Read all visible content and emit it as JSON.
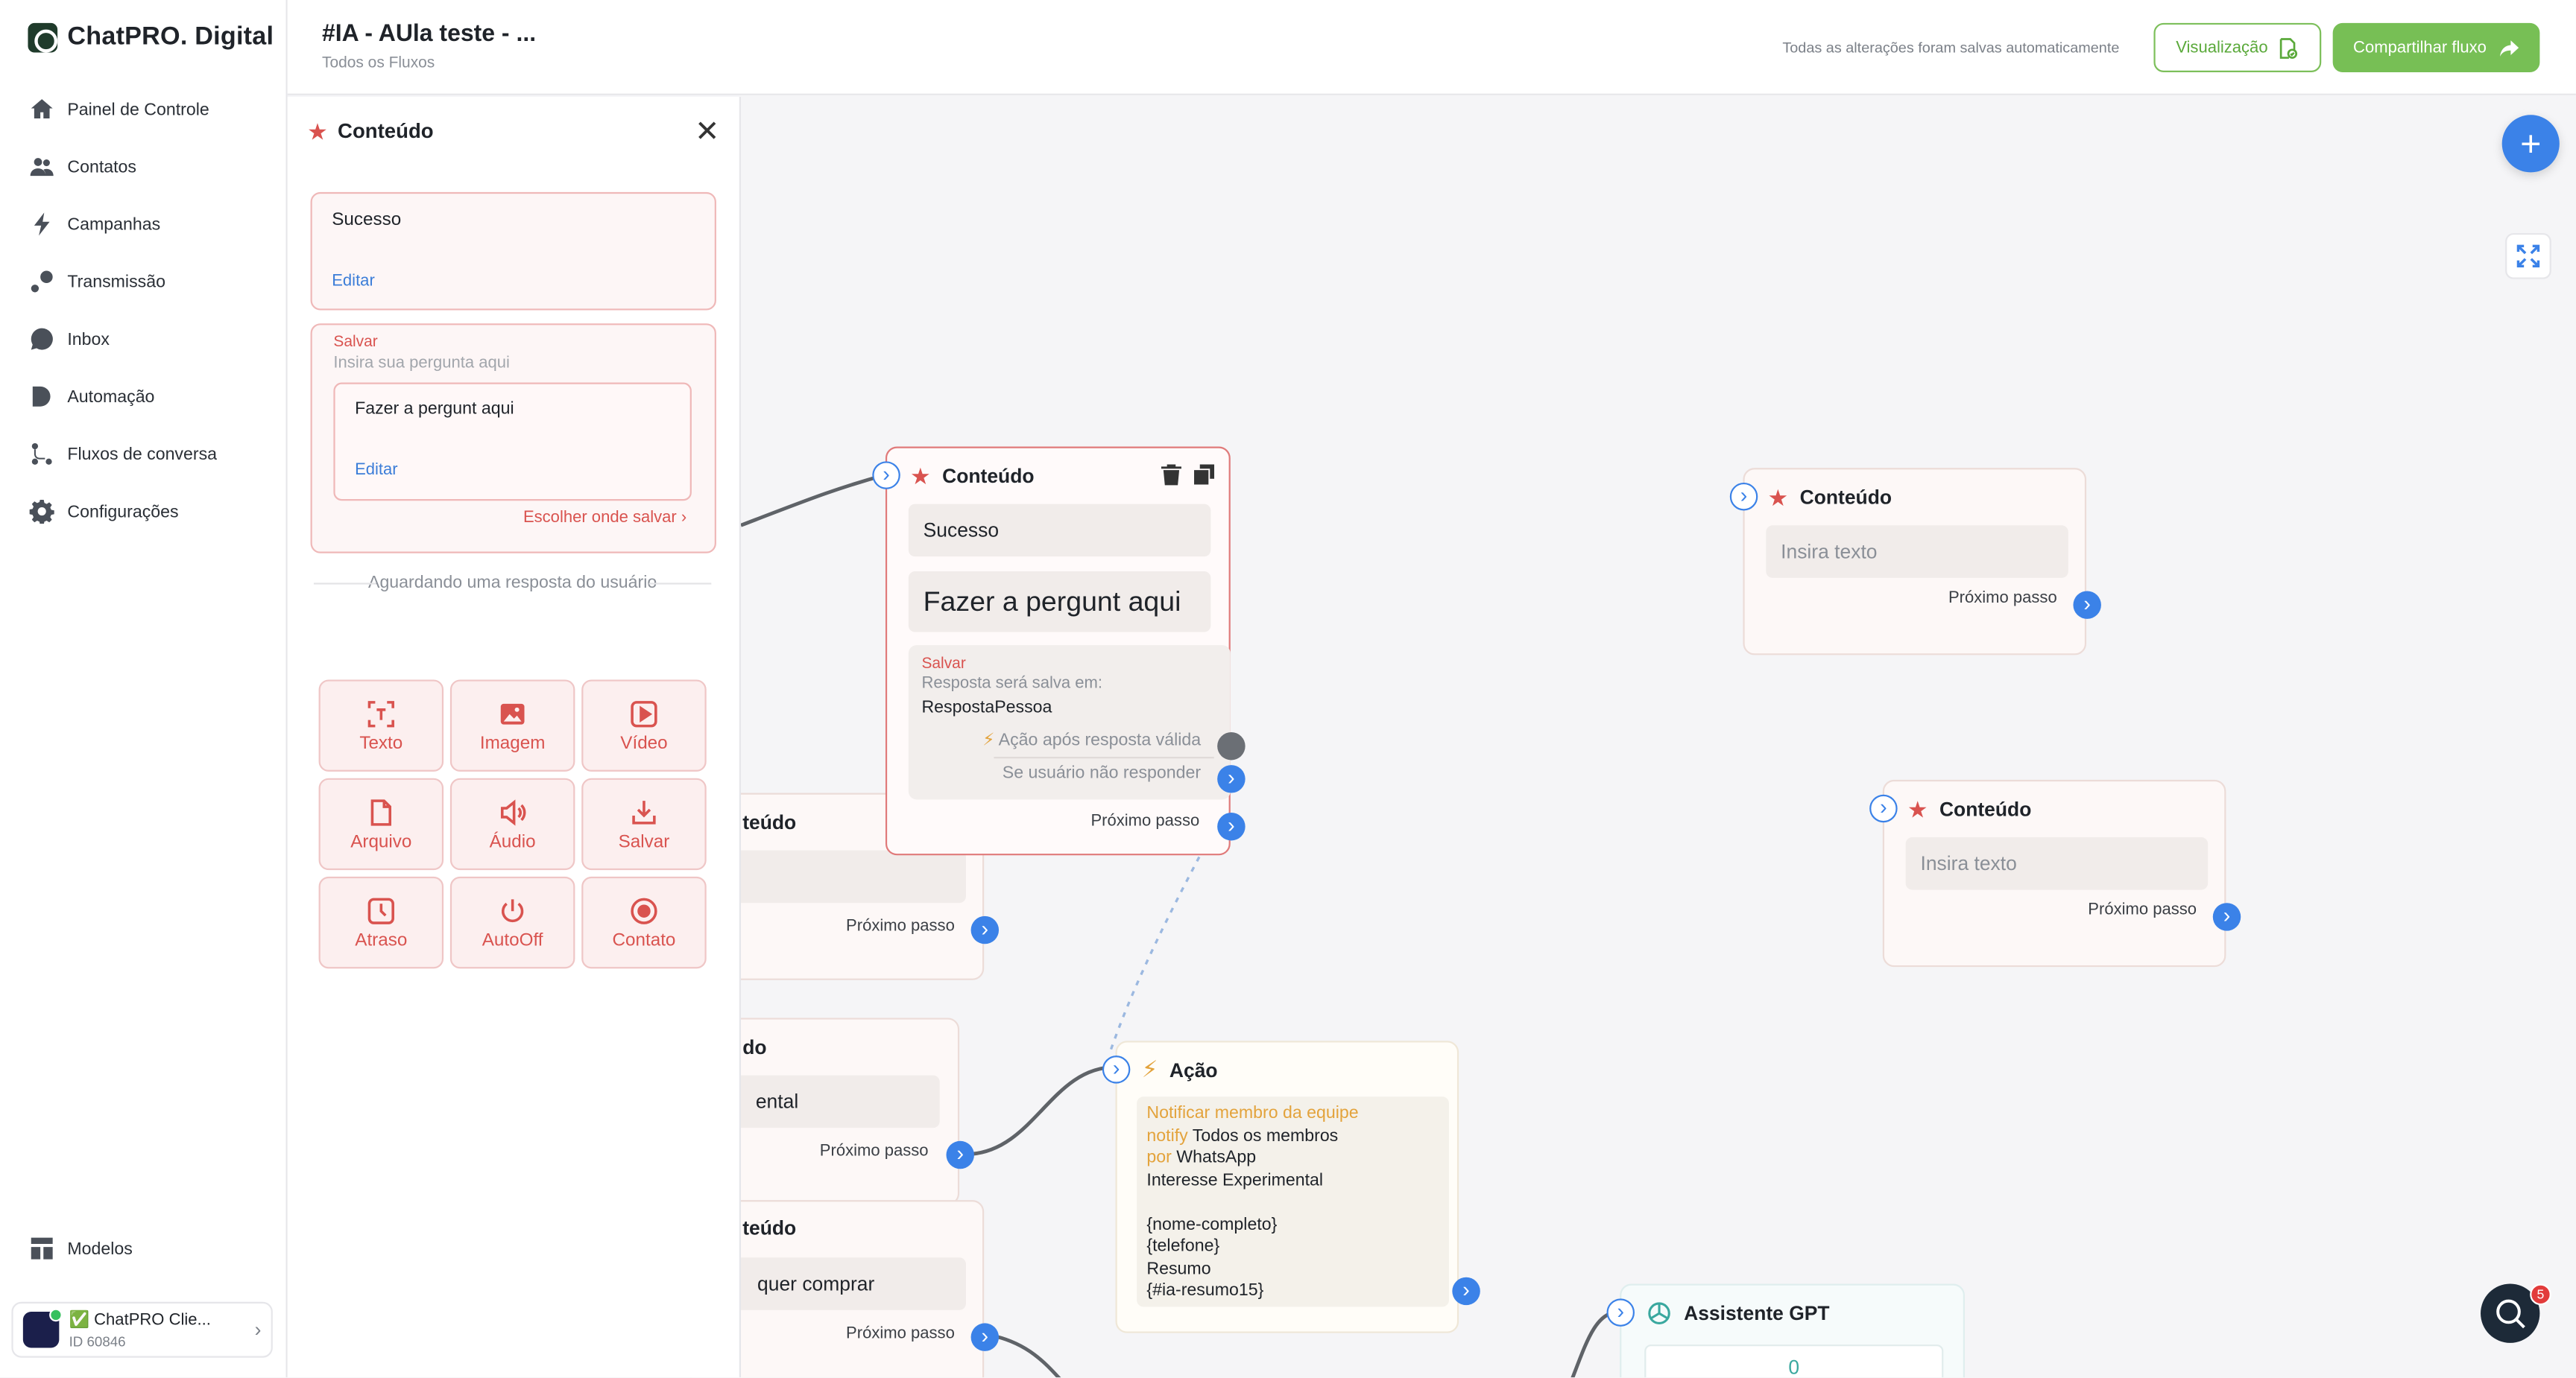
{
  "brand": {
    "name": "ChatPRO. Digital"
  },
  "sidebar": {
    "items": [
      {
        "label": "Painel de Controle",
        "icon": "home-icon"
      },
      {
        "label": "Contatos",
        "icon": "users-icon"
      },
      {
        "label": "Campanhas",
        "icon": "bolt-icon"
      },
      {
        "label": "Transmissão",
        "icon": "broadcast-icon"
      },
      {
        "label": "Inbox",
        "icon": "chat-bubble-icon"
      },
      {
        "label": "Automação",
        "icon": "automation-icon"
      },
      {
        "label": "Fluxos de conversa",
        "icon": "flow-icon"
      },
      {
        "label": "Configurações",
        "icon": "gear-icon"
      }
    ],
    "bottom_item": {
      "label": "Modelos",
      "icon": "templates-icon"
    },
    "account": {
      "name": "✅ ChatPRO Clie...",
      "id": "ID 60846"
    }
  },
  "header": {
    "title": "#IA - AUla teste - ...",
    "breadcrumb": "Todos os Fluxos",
    "autosave": "Todas as alterações foram salvas automaticamente",
    "preview_label": "Visualização",
    "share_label": "Compartilhar fluxo"
  },
  "panel": {
    "title": "Conteúdo",
    "box1_text": "Sucesso",
    "box1_edit": "Editar",
    "save_label": "Salvar",
    "question_placeholder": "Insira sua pergunta aqui",
    "question_text": "Fazer a pergunt aqui",
    "question_edit": "Editar",
    "choose_save": "Escolher onde salvar",
    "waiting": "Aguardando uma resposta do usuário",
    "buttons": [
      {
        "label": "Texto",
        "icon": "text-icon"
      },
      {
        "label": "Imagem",
        "icon": "image-icon"
      },
      {
        "label": "Vídeo",
        "icon": "video-icon"
      },
      {
        "label": "Arquivo",
        "icon": "file-icon"
      },
      {
        "label": "Áudio",
        "icon": "audio-icon"
      },
      {
        "label": "Salvar",
        "icon": "download-icon"
      },
      {
        "label": "Atraso",
        "icon": "clock-icon"
      },
      {
        "label": "AutoOff",
        "icon": "power-icon"
      },
      {
        "label": "Contato",
        "icon": "contact-icon"
      }
    ]
  },
  "canvas": {
    "selected_node": {
      "title": "Conteúdo",
      "field1": "Sucesso",
      "field2": "Fazer a pergunt aqui",
      "save_label": "Salvar",
      "save_sub": "Resposta será salva em:",
      "save_value": "RespostaPessoa",
      "action_after": "Ação após resposta válida",
      "no_response": "Se usuário não responder",
      "next": "Próximo passo"
    },
    "node_right_1": {
      "title": "Conteúdo",
      "placeholder": "Insira texto",
      "next": "Próximo passo"
    },
    "node_right_2": {
      "title": "Conteúdo",
      "placeholder": "Insira texto",
      "next": "Próximo passo"
    },
    "partial_node_1": {
      "title": "teúdo",
      "next": "Próximo passo"
    },
    "partial_node_2": {
      "title": "do",
      "field": "ental",
      "next": "Próximo passo"
    },
    "partial_node_3": {
      "title": "teúdo",
      "field": "quer comprar",
      "next": "Próximo passo"
    },
    "action_node": {
      "title": "Ação",
      "notify_label": "Notificar membro da equipe",
      "notify_word": "notify",
      "notify_target": "Todos os membros",
      "por_word": "por",
      "channel": "WhatsApp",
      "line3": "Interesse Experimental",
      "line4": "{nome-completo}",
      "line5": "{telefone}",
      "line6": "Resumo",
      "line7": "{#ia-resumo15}"
    },
    "gpt_node": {
      "title": "Assistente GPT",
      "value": "0"
    },
    "chat_badge": "5"
  },
  "colors": {
    "accent_blue": "#3b82e8",
    "brand_green": "#77bf55",
    "content_red": "#d9534f",
    "action_orange": "#e3a33c"
  }
}
